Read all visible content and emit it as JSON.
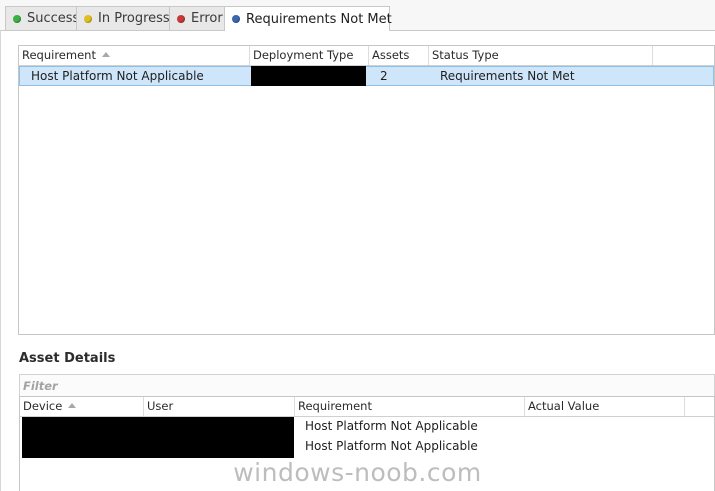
{
  "tabs": [
    {
      "label": "Success",
      "color": "#3cb043"
    },
    {
      "label": "In Progress",
      "color": "#e0c020"
    },
    {
      "label": "Error",
      "color": "#c83a3a"
    },
    {
      "label": "Requirements Not Met",
      "color": "#3b66b0"
    }
  ],
  "requirements_grid": {
    "columns": [
      "Requirement",
      "Deployment Type",
      "Assets",
      "Status Type"
    ],
    "rows": [
      {
        "requirement": "Host Platform Not Applicable",
        "deployment_type": "",
        "assets": "2",
        "status_type": "Requirements Not Met"
      }
    ]
  },
  "asset_details": {
    "title": "Asset Details",
    "filter_placeholder": "Filter",
    "columns": [
      "Device",
      "User",
      "Requirement",
      "Actual Value"
    ],
    "rows": [
      {
        "device": "",
        "user": "",
        "requirement": "Host Platform Not Applicable",
        "actual_value": ""
      },
      {
        "device": "",
        "user": "",
        "requirement": "Host Platform Not Applicable",
        "actual_value": ""
      }
    ]
  },
  "watermark": "windows-noob.com"
}
